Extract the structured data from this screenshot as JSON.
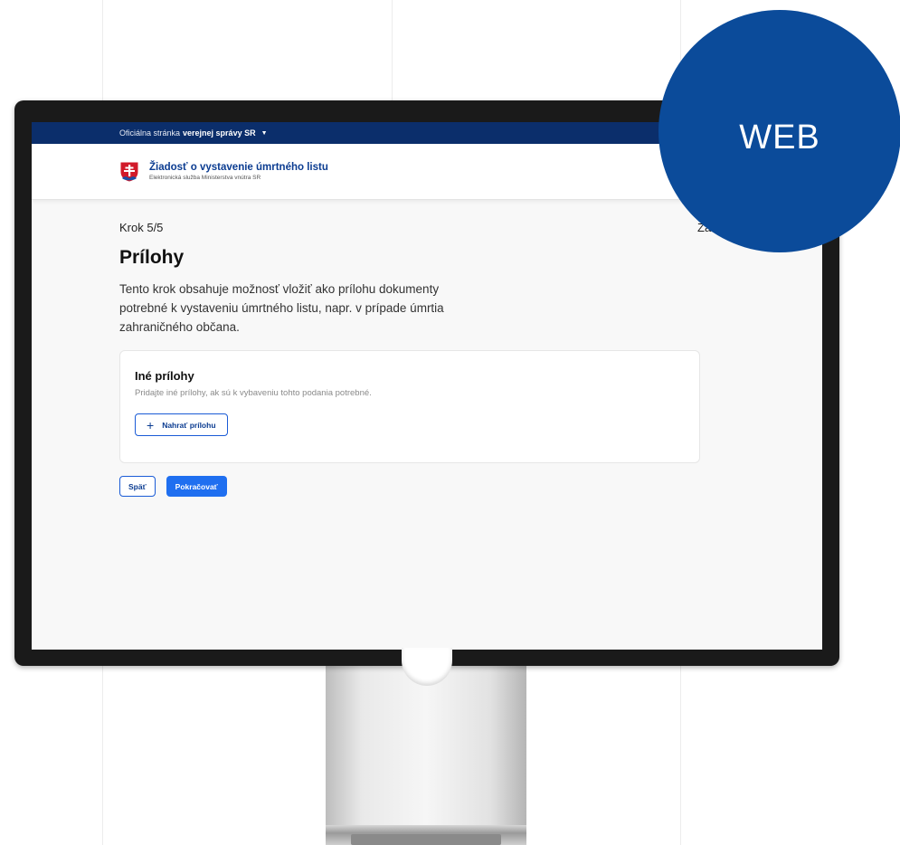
{
  "govbar": {
    "text": "Oficiálna stránka",
    "bold": "verejnej správy SR"
  },
  "header": {
    "title": "Žiadosť o vystavenie úmrtného listu",
    "subtitle": "Elektronická služba Ministerstva vnútra SR"
  },
  "main": {
    "step": "Krok 5/5",
    "close": "Zavrieť",
    "title": "Prílohy",
    "lead": "Tento krok obsahuje možnosť vložiť ako prílohu dokumenty potrebné k vystaveniu úmrtného listu, napr. v prípade úmrtia zahraničného občana."
  },
  "card": {
    "title": "Iné prílohy",
    "description": "Pridajte iné prílohy, ak sú k vybaveniu tohto podania potrebné.",
    "upload_label": "Nahrať prílohu"
  },
  "actions": {
    "back": "Späť",
    "next": "Pokračovať"
  },
  "badge": {
    "label": "WEB"
  },
  "colors": {
    "gov_bar": "#0b2e6b",
    "primary": "#1f6ff0",
    "badge": "#0b4b9a"
  }
}
